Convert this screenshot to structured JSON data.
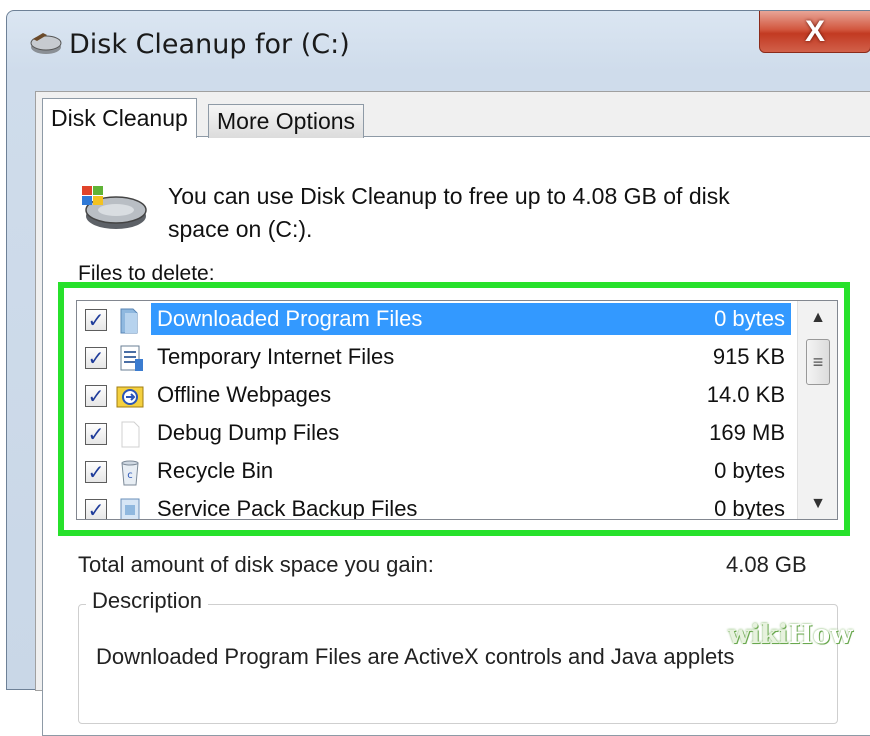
{
  "window": {
    "title": "Disk Cleanup for  (C:)",
    "close_label": "X",
    "icon": "disk-cleanup-icon"
  },
  "tabs": [
    {
      "label": "Disk Cleanup",
      "active": true
    },
    {
      "label": "More Options",
      "active": false
    }
  ],
  "intro_text": "You can use Disk Cleanup to free up to 4.08 GB of disk space on  (C:).",
  "files_label": "Files to delete:",
  "files": [
    {
      "checked": true,
      "icon": "folder-icon",
      "name": "Downloaded Program Files",
      "size": "0 bytes",
      "selected": true
    },
    {
      "checked": true,
      "icon": "document-icon",
      "name": "Temporary Internet Files",
      "size": "915 KB",
      "selected": false
    },
    {
      "checked": true,
      "icon": "offline-webpages-icon",
      "name": "Offline Webpages",
      "size": "14.0 KB",
      "selected": false
    },
    {
      "checked": true,
      "icon": "blank-file-icon",
      "name": "Debug Dump Files",
      "size": "169 MB",
      "selected": false
    },
    {
      "checked": true,
      "icon": "recycle-bin-icon",
      "name": "Recycle Bin",
      "size": "0 bytes",
      "selected": false
    },
    {
      "checked": true,
      "icon": "backup-icon",
      "name": "Service Pack Backup Files",
      "size": "0 bytes",
      "selected": false
    }
  ],
  "total_label": "Total amount of disk space you gain:",
  "total_value": "4.08 GB",
  "description_label": "Description",
  "description_text": "Downloaded Program Files are ActiveX controls and Java applets",
  "watermark": {
    "wiki": "wiki",
    "how": "How"
  },
  "colors": {
    "highlight": "#27e12b",
    "selection": "#3399ff",
    "close_button": "#c8452e"
  }
}
